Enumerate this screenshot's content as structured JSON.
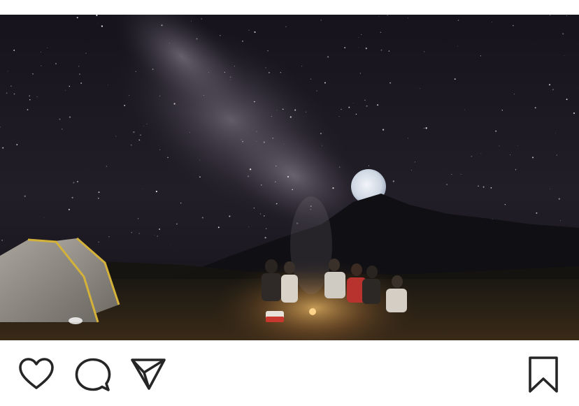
{
  "post": {
    "image": {
      "subject": "night-sky-campsite-photo",
      "palette": {
        "sky_top": "#1a1620",
        "sky_mid": "#2a2530",
        "milky_way": "#8a8290",
        "moon": "#dde4ee",
        "mountain": "#111014",
        "ground": "#3a2a18",
        "fire_glow": "#f2b35a",
        "tent": "#8f8a82",
        "tent_trim": "#d4b23a"
      }
    },
    "actions": {
      "like": {
        "icon": "heart-outline-icon"
      },
      "comment": {
        "icon": "speech-bubble-icon"
      },
      "share": {
        "icon": "paper-plane-icon"
      },
      "save": {
        "icon": "bookmark-outline-icon"
      }
    },
    "colors": {
      "icon_stroke": "#262626",
      "background": "#ffffff"
    }
  }
}
